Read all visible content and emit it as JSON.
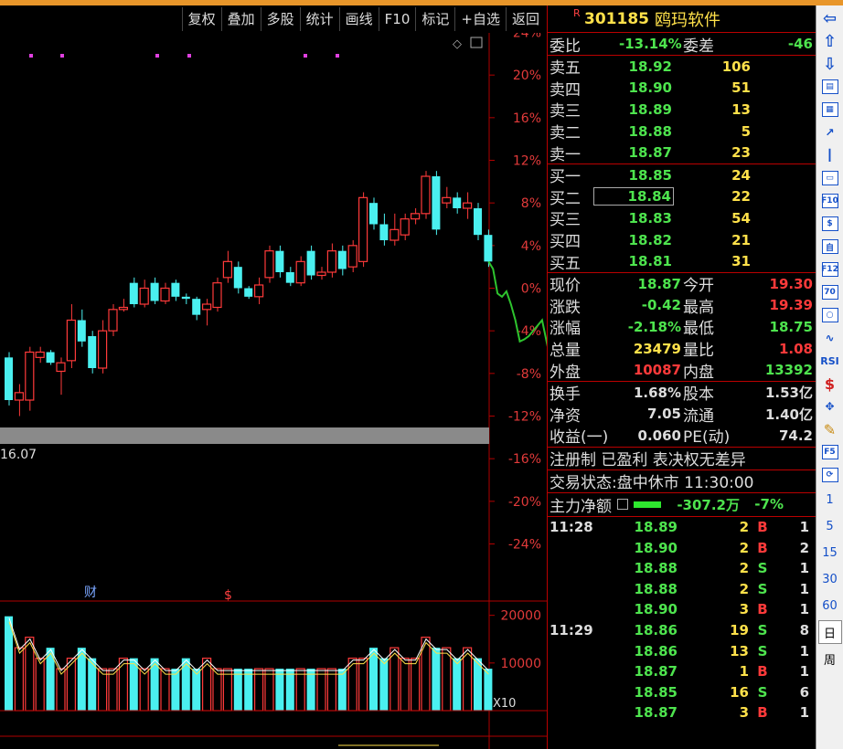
{
  "toolbar": {
    "buttons": [
      "复权",
      "叠加",
      "多股",
      "统计",
      "画线",
      "F10",
      "标记",
      "+自选",
      "返回"
    ]
  },
  "chart": {
    "percent_axis": [
      "24%",
      "20%",
      "16%",
      "12%",
      "8%",
      "4%",
      "0%",
      "-4%",
      "-8%",
      "-12%",
      "-16%",
      "-20%",
      "-24%"
    ],
    "price_low_label": "16.07",
    "event_labels": {
      "finance": "财",
      "dollar": "$"
    },
    "volume_axis": [
      "20000",
      "10000"
    ],
    "volume_multiplier": "X10",
    "colors": {
      "up": "#ff3a3a",
      "down": "#4af0f0",
      "intraday": "#2ec42e",
      "axis": "#b00000",
      "purple": "#e040e0"
    }
  },
  "chart_data": {
    "type": "candlestick",
    "intraday_pct_note": "",
    "candles": [
      {
        "o": -6.5,
        "c": -10.5,
        "h": -6.0,
        "l": -11.0
      },
      {
        "o": -10.5,
        "c": -9.8,
        "h": -9.0,
        "l": -12.0
      },
      {
        "o": -10.5,
        "c": -6.0,
        "h": -5.5,
        "l": -11.5
      },
      {
        "o": -6.5,
        "c": -6.0,
        "h": -5.5,
        "l": -7.0
      },
      {
        "o": -6.0,
        "c": -7.0,
        "h": -5.8,
        "l": -7.2
      },
      {
        "o": -7.8,
        "c": -7.0,
        "h": -6.5,
        "l": -10.0
      },
      {
        "o": -6.8,
        "c": -3.0,
        "h": -1.5,
        "l": -7.5
      },
      {
        "o": -3.0,
        "c": -5.0,
        "h": -2.0,
        "l": -5.5
      },
      {
        "o": -4.5,
        "c": -7.5,
        "h": -4.0,
        "l": -8.0
      },
      {
        "o": -7.5,
        "c": -4.0,
        "h": -3.0,
        "l": -8.0
      },
      {
        "o": -4.0,
        "c": -2.0,
        "h": -1.5,
        "l": -4.5
      },
      {
        "o": -2.0,
        "c": -1.8,
        "h": -1.0,
        "l": -2.2
      },
      {
        "o": 0.5,
        "c": -1.5,
        "h": 1.0,
        "l": -1.8
      },
      {
        "o": -1.5,
        "c": 0.0,
        "h": 0.8,
        "l": -1.8
      },
      {
        "o": 0.5,
        "c": -1.2,
        "h": 1.0,
        "l": -1.5
      },
      {
        "o": -1.2,
        "c": 0.0,
        "h": 0.5,
        "l": -1.5
      },
      {
        "o": 0.5,
        "c": -0.8,
        "h": 0.8,
        "l": -1.2
      },
      {
        "o": -0.8,
        "c": -1.0,
        "h": -0.5,
        "l": -1.5
      },
      {
        "o": -1.0,
        "c": -2.5,
        "h": -0.8,
        "l": -3.0
      },
      {
        "o": -2.0,
        "c": -1.5,
        "h": -1.0,
        "l": -3.5
      },
      {
        "o": -1.8,
        "c": 0.5,
        "h": 1.0,
        "l": -2.2
      },
      {
        "o": 1.0,
        "c": 2.5,
        "h": 3.5,
        "l": 0.5
      },
      {
        "o": 2.0,
        "c": 0.0,
        "h": 2.5,
        "l": -0.5
      },
      {
        "o": 0.0,
        "c": -0.8,
        "h": 0.2,
        "l": -1.0
      },
      {
        "o": -0.8,
        "c": 0.3,
        "h": 1.0,
        "l": -1.5
      },
      {
        "o": 1.0,
        "c": 3.5,
        "h": 4.0,
        "l": 0.5
      },
      {
        "o": 3.5,
        "c": 1.5,
        "h": 4.0,
        "l": 1.0
      },
      {
        "o": 1.5,
        "c": 0.5,
        "h": 2.0,
        "l": 0.2
      },
      {
        "o": 0.5,
        "c": 2.5,
        "h": 3.0,
        "l": 0.2
      },
      {
        "o": 3.5,
        "c": 1.2,
        "h": 4.0,
        "l": 0.8
      },
      {
        "o": 1.2,
        "c": 1.5,
        "h": 2.0,
        "l": 0.8
      },
      {
        "o": 1.5,
        "c": 3.5,
        "h": 4.2,
        "l": 1.0
      },
      {
        "o": 3.5,
        "c": 1.8,
        "h": 4.0,
        "l": 1.2
      },
      {
        "o": 2.0,
        "c": 4.0,
        "h": 4.5,
        "l": 1.5
      },
      {
        "o": 2.5,
        "c": 8.5,
        "h": 9.0,
        "l": 2.0
      },
      {
        "o": 8.0,
        "c": 6.0,
        "h": 8.5,
        "l": 5.5
      },
      {
        "o": 6.0,
        "c": 4.5,
        "h": 7.0,
        "l": 4.0
      },
      {
        "o": 4.5,
        "c": 5.5,
        "h": 7.0,
        "l": 4.0
      },
      {
        "o": 5.0,
        "c": 6.5,
        "h": 7.0,
        "l": 4.5
      },
      {
        "o": 6.5,
        "c": 7.0,
        "h": 7.5,
        "l": 6.0
      },
      {
        "o": 7.0,
        "c": 10.5,
        "h": 11.0,
        "l": 6.5
      },
      {
        "o": 10.5,
        "c": 5.5,
        "h": 11.0,
        "l": 5.0
      },
      {
        "o": 8.0,
        "c": 8.5,
        "h": 9.5,
        "l": 7.5
      },
      {
        "o": 8.5,
        "c": 7.5,
        "h": 9.0,
        "l": 7.0
      },
      {
        "o": 7.5,
        "c": 8.0,
        "h": 9.0,
        "l": 6.5
      },
      {
        "o": 7.5,
        "c": 5.0,
        "h": 8.0,
        "l": 4.5
      },
      {
        "o": 5.0,
        "c": 2.5,
        "h": 5.5,
        "l": 2.0
      }
    ],
    "intraday": [
      2.5,
      1.8,
      -0.5,
      -0.8,
      -0.3,
      -1.5,
      -3.0,
      -5.0,
      -4.8,
      -4.5,
      -4.0,
      -3.5,
      -3.0,
      -5.0,
      -7.0,
      -9.0,
      -10.5
    ],
    "volumes": [
      9,
      6,
      7,
      5,
      6,
      4,
      5,
      6,
      5,
      4,
      4,
      5,
      5,
      4,
      5,
      4,
      4,
      5,
      4,
      5,
      4,
      4,
      4,
      4,
      4,
      4,
      4,
      4,
      4,
      4,
      4,
      4,
      4,
      5,
      5,
      6,
      5,
      6,
      5,
      5,
      7,
      6,
      6,
      5,
      6,
      5,
      4
    ],
    "volume_ylim": [
      0,
      23000
    ],
    "pct_ylim": [
      -26,
      26
    ]
  },
  "quote": {
    "code": "301185",
    "name": "鸥玛软件",
    "r_mark": "R",
    "weibi_label": "委比",
    "weibi_value": "-13.14%",
    "weicha_label": "委差",
    "weicha_value": "-46",
    "asks": [
      {
        "label": "卖五",
        "price": "18.92",
        "vol": "106"
      },
      {
        "label": "卖四",
        "price": "18.90",
        "vol": "51"
      },
      {
        "label": "卖三",
        "price": "18.89",
        "vol": "13"
      },
      {
        "label": "卖二",
        "price": "18.88",
        "vol": "5"
      },
      {
        "label": "卖一",
        "price": "18.87",
        "vol": "23"
      }
    ],
    "bids": [
      {
        "label": "买一",
        "price": "18.85",
        "vol": "24"
      },
      {
        "label": "买二",
        "price": "18.84",
        "vol": "22"
      },
      {
        "label": "买三",
        "price": "18.83",
        "vol": "54"
      },
      {
        "label": "买四",
        "price": "18.82",
        "vol": "21"
      },
      {
        "label": "买五",
        "price": "18.81",
        "vol": "31"
      }
    ],
    "stats": [
      {
        "l1": "现价",
        "v1": "18.87",
        "c1": "grn",
        "l2": "今开",
        "v2": "19.30",
        "c2": "red"
      },
      {
        "l1": "涨跌",
        "v1": "-0.42",
        "c1": "grn",
        "l2": "最高",
        "v2": "19.39",
        "c2": "red"
      },
      {
        "l1": "涨幅",
        "v1": "-2.18%",
        "c1": "grn",
        "l2": "最低",
        "v2": "18.75",
        "c2": "grn"
      },
      {
        "l1": "总量",
        "v1": "23479",
        "c1": "yel",
        "l2": "量比",
        "v2": "1.08",
        "c2": "red"
      },
      {
        "l1": "外盘",
        "v1": "10087",
        "c1": "red",
        "l2": "内盘",
        "v2": "13392",
        "c2": "grn"
      }
    ],
    "fund": [
      {
        "l1": "换手",
        "v1": "1.68%",
        "l2": "股本",
        "v2": "1.53亿"
      },
      {
        "l1": "净资",
        "v1": "7.05",
        "l2": "流通",
        "v2": "1.40亿"
      },
      {
        "l1": "收益(一)",
        "v1": "0.060",
        "l2": "PE(动)",
        "v2": "74.2"
      }
    ],
    "tags_line": "注册制 已盈利 表决权无差异",
    "status_label": "交易状态:",
    "status_value": "盘中休市 11:30:00",
    "main_force_label": "主力净额",
    "main_force_value": "-307.2万",
    "main_force_pct": "-7%",
    "ticks": [
      {
        "time": "11:28",
        "price": "18.89",
        "vol": "2",
        "side": "B",
        "n": "1"
      },
      {
        "time": "",
        "price": "18.90",
        "vol": "2",
        "side": "B",
        "n": "2"
      },
      {
        "time": "",
        "price": "18.88",
        "vol": "2",
        "side": "S",
        "n": "1"
      },
      {
        "time": "",
        "price": "18.88",
        "vol": "2",
        "side": "S",
        "n": "1"
      },
      {
        "time": "",
        "price": "18.90",
        "vol": "3",
        "side": "B",
        "n": "1"
      },
      {
        "time": "11:29",
        "price": "18.86",
        "vol": "19",
        "side": "S",
        "n": "8"
      },
      {
        "time": "",
        "price": "18.86",
        "vol": "13",
        "side": "S",
        "n": "1"
      },
      {
        "time": "",
        "price": "18.87",
        "vol": "1",
        "side": "B",
        "n": "1"
      },
      {
        "time": "",
        "price": "18.85",
        "vol": "16",
        "side": "S",
        "n": "6"
      },
      {
        "time": "",
        "price": "18.87",
        "vol": "3",
        "side": "B",
        "n": "1"
      }
    ]
  },
  "side_toolbar": {
    "items": [
      "arrow-left-icon",
      "arrow-up-icon",
      "arrow-down-icon",
      "report-icon",
      "grid-icon",
      "line-chart-icon",
      "candle-icon",
      "window-icon",
      "F10",
      "trade-icon",
      "self-icon",
      "F12",
      "70",
      "circle-icon",
      "wave-icon",
      "RSI",
      "dollar-icon",
      "move-icon",
      "pen-icon",
      "F5",
      "refresh-icon"
    ],
    "numbers": [
      "1",
      "5",
      "15",
      "30",
      "60"
    ],
    "day_label": "日",
    "week_label": "周"
  }
}
